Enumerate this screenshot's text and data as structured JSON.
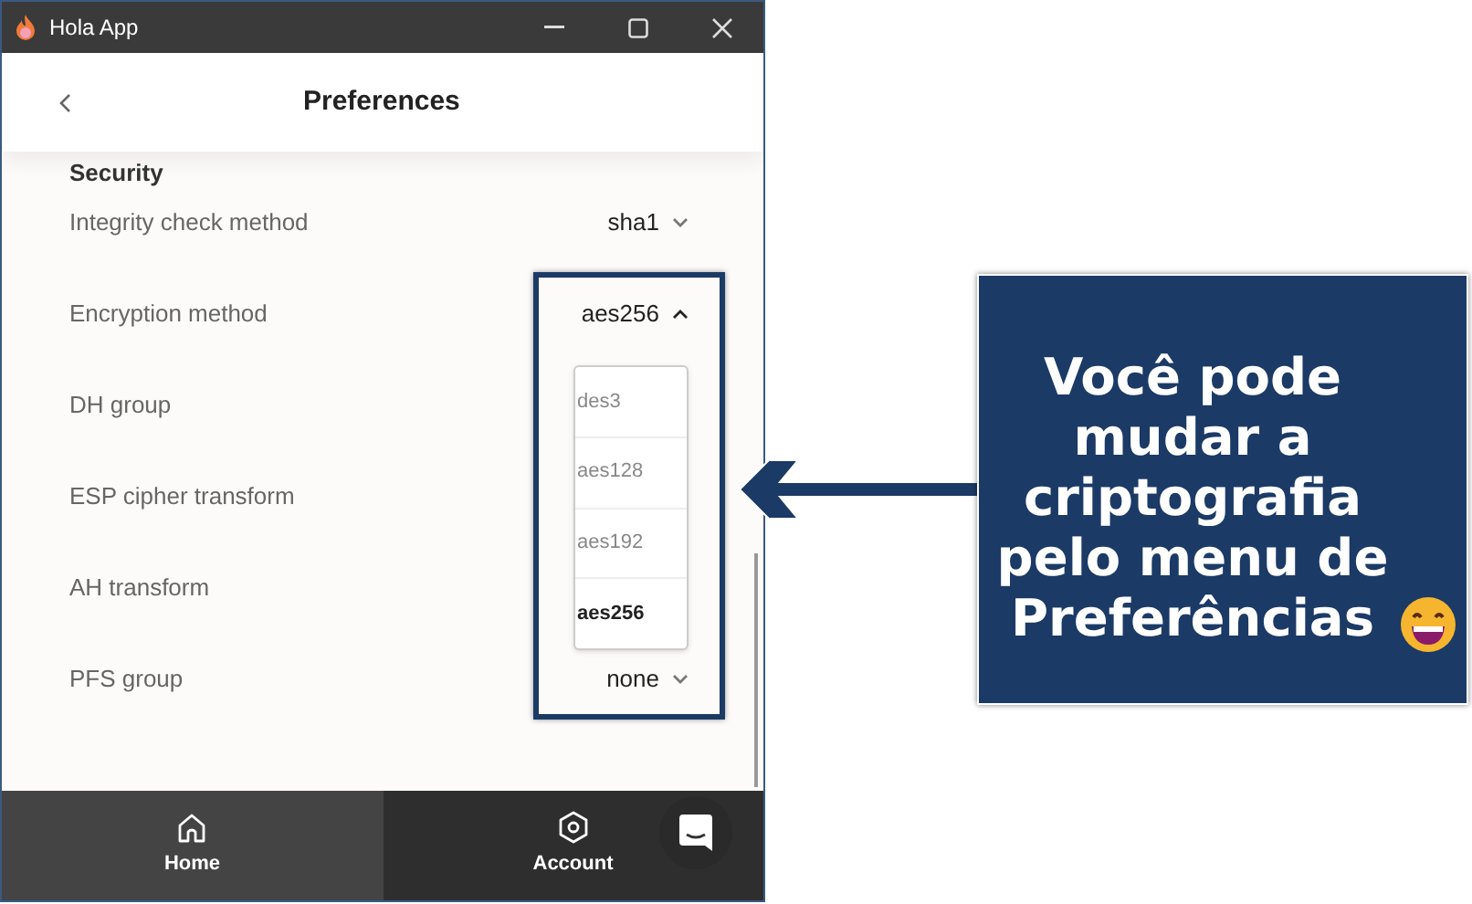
{
  "window": {
    "title": "Hola App"
  },
  "header": {
    "title": "Preferences"
  },
  "section": {
    "title": "Security"
  },
  "rows": [
    {
      "label": "Integrity check method",
      "value": "sha1",
      "expanded": false
    },
    {
      "label": "Encryption method",
      "value": "aes256",
      "expanded": true
    },
    {
      "label": "DH group"
    },
    {
      "label": "ESP cipher transform"
    },
    {
      "label": "AH transform"
    },
    {
      "label": "PFS group",
      "value": "none",
      "expanded": false
    }
  ],
  "dropdown": {
    "options": [
      {
        "label": "des3",
        "selected": false
      },
      {
        "label": "aes128",
        "selected": false
      },
      {
        "label": "aes192",
        "selected": false
      },
      {
        "label": "aes256",
        "selected": true
      }
    ]
  },
  "nav": [
    {
      "label": "Home",
      "kind": "home",
      "selected": true
    },
    {
      "label": "Account",
      "kind": "account",
      "selected": false
    }
  ],
  "callout": {
    "text": "Você pode mudar a criptografia pelo menu de Preferências"
  }
}
